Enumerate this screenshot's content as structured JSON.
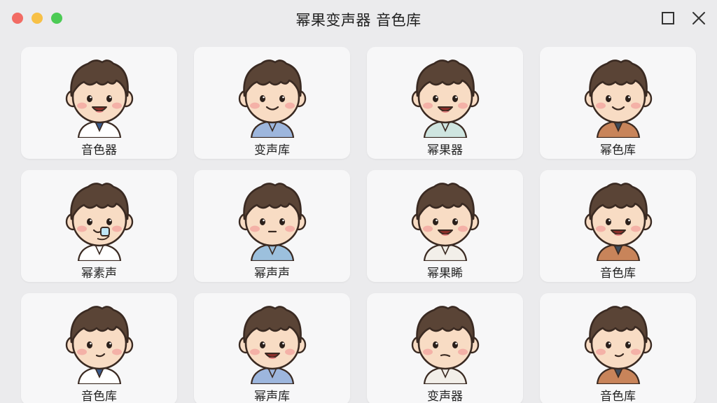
{
  "window": {
    "title": "幂果变声器 音色库"
  },
  "colors": {
    "close": "#f26b64",
    "minimize": "#f7c046",
    "maximize": "#4ccb55",
    "hair": "#5a4436",
    "skin": "#f8dcc4",
    "cheek": "#f2a6a0"
  },
  "voices": [
    {
      "label": "音色器",
      "mouth": "open",
      "shirt": "#ffffff",
      "collar": "#3a5a8a"
    },
    {
      "label": "变声库",
      "mouth": "smile",
      "shirt": "#9db6dd",
      "collar": "#9db6dd"
    },
    {
      "label": "幂果器",
      "mouth": "open",
      "shirt": "#cfe5e0",
      "collar": "#cfe5e0"
    },
    {
      "label": "幂色库",
      "mouth": "smile",
      "shirt": "#c8845a",
      "collar": "#3c4a5a"
    },
    {
      "label": "幂素声",
      "mouth": "mic",
      "shirt": "#ffffff",
      "collar": "#ffffff"
    },
    {
      "label": "幂声声",
      "mouth": "flat",
      "shirt": "#9cc0dd",
      "collar": "#9cc0dd"
    },
    {
      "label": "幂果睎",
      "mouth": "open",
      "shirt": "#f2efe9",
      "collar": "#f2efe9"
    },
    {
      "label": "音色库",
      "mouth": "open",
      "shirt": "#c8845a",
      "collar": "#3c4a5a"
    },
    {
      "label": "音色库",
      "mouth": "smirk",
      "shirt": "#ffffff",
      "collar": "#3a5a8a"
    },
    {
      "label": "幂声库",
      "mouth": "open",
      "shirt": "#9db6dd",
      "collar": "#9db6dd"
    },
    {
      "label": "变声器",
      "mouth": "neutral",
      "shirt": "#f2efe9",
      "collar": "#f2efe9"
    },
    {
      "label": "音色库",
      "mouth": "smirk",
      "shirt": "#c8845a",
      "collar": "#3c4a5a"
    }
  ]
}
